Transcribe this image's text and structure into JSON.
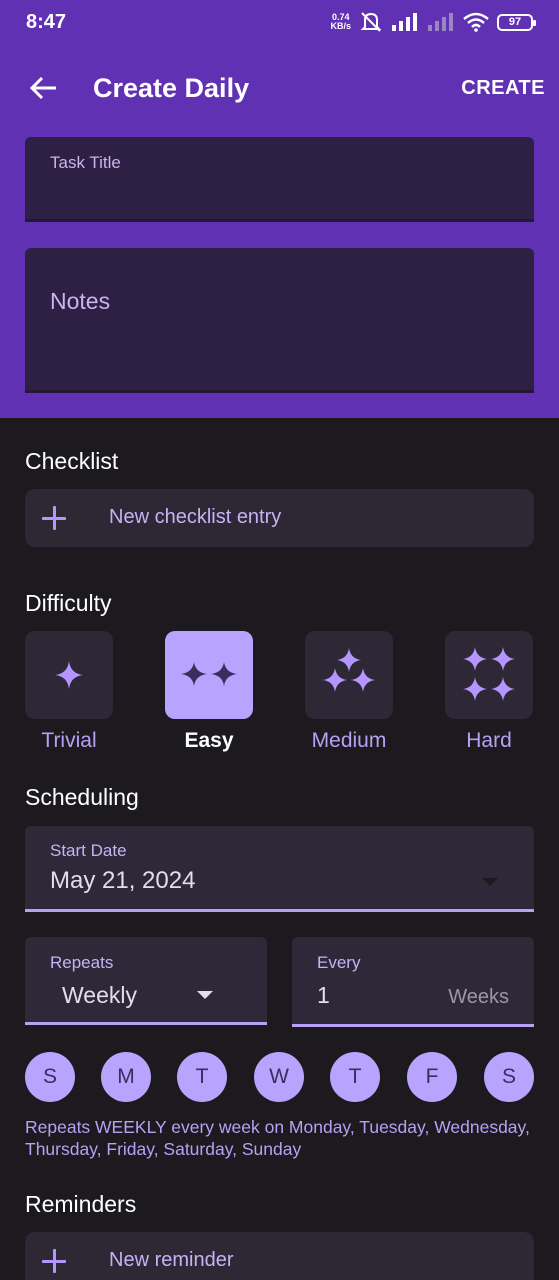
{
  "status": {
    "time": "8:47",
    "speed_top": "0.74",
    "speed_bottom": "KB/s",
    "battery": "97"
  },
  "appbar": {
    "title": "Create Daily",
    "action": "CREATE"
  },
  "form": {
    "task_title_label": "Task Title",
    "notes_placeholder": "Notes"
  },
  "checklist": {
    "title": "Checklist",
    "new_entry": "New checklist entry"
  },
  "difficulty": {
    "title": "Difficulty",
    "options": [
      {
        "label": "Trivial",
        "stars": 1,
        "selected": false
      },
      {
        "label": "Easy",
        "stars": 2,
        "selected": true
      },
      {
        "label": "Medium",
        "stars": 3,
        "selected": false
      },
      {
        "label": "Hard",
        "stars": 4,
        "selected": false
      }
    ]
  },
  "scheduling": {
    "title": "Scheduling",
    "start_date_label": "Start Date",
    "start_date_value": "May 21, 2024",
    "repeats_label": "Repeats",
    "repeats_value": "Weekly",
    "every_label": "Every",
    "every_value": "1",
    "every_unit": "Weeks",
    "days": [
      "S",
      "M",
      "T",
      "W",
      "T",
      "F",
      "S"
    ],
    "summary": "Repeats WEEKLY every week  on Monday, Tuesday, Wednesday, Thursday, Friday, Saturday, Sunday"
  },
  "reminders": {
    "title": "Reminders",
    "new_reminder": "New reminder"
  },
  "colors": {
    "header_bg": "#6131b3",
    "page_bg": "#1c1a1f",
    "accent": "#b8a3ff"
  }
}
